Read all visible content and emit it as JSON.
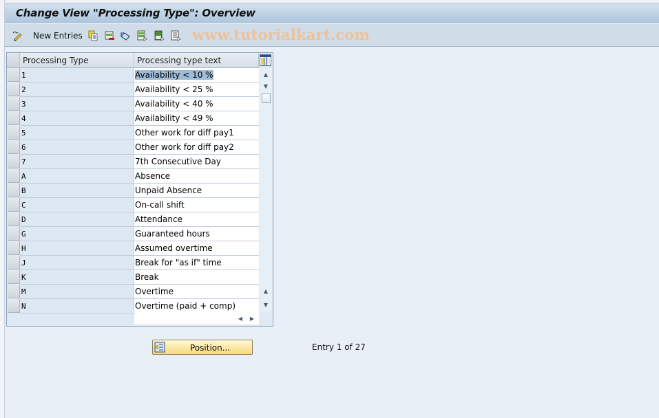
{
  "window": {
    "title": "Change View \"Processing Type\": Overview"
  },
  "toolbar": {
    "items": [
      {
        "icon": "edit-pencil-icon",
        "label": ""
      },
      {
        "icon": "",
        "label": "New Entries"
      },
      {
        "icon": "copy-icon",
        "label": ""
      },
      {
        "icon": "delete-icon",
        "label": ""
      },
      {
        "icon": "undo-change-icon",
        "label": ""
      },
      {
        "icon": "select-all-icon",
        "label": ""
      },
      {
        "icon": "select-block-icon",
        "label": ""
      },
      {
        "icon": "deselect-all-icon",
        "label": ""
      }
    ],
    "new_entries_label": "New Entries",
    "watermark": "www.tutorialkart.com"
  },
  "table": {
    "columns": [
      "Processing Type",
      "Processing type text"
    ],
    "rows": [
      {
        "key": "1",
        "text": "Availability < 10 %",
        "selected": true
      },
      {
        "key": "2",
        "text": "Availability < 25 %"
      },
      {
        "key": "3",
        "text": "Availability < 40 %"
      },
      {
        "key": "4",
        "text": "Availability < 49 %"
      },
      {
        "key": "5",
        "text": "Other work for diff pay1"
      },
      {
        "key": "6",
        "text": "Other work for diff pay2"
      },
      {
        "key": "7",
        "text": "7th Consecutive Day"
      },
      {
        "key": "A",
        "text": "Absence"
      },
      {
        "key": "B",
        "text": "Unpaid Absence"
      },
      {
        "key": "C",
        "text": "On-call shift"
      },
      {
        "key": "D",
        "text": "Attendance"
      },
      {
        "key": "G",
        "text": "Guaranteed hours"
      },
      {
        "key": "H",
        "text": "Assumed overtime"
      },
      {
        "key": "J",
        "text": "Break for \"as if\" time"
      },
      {
        "key": "K",
        "text": "Break"
      },
      {
        "key": "M",
        "text": "Overtime"
      },
      {
        "key": "N",
        "text": "Overtime (paid + comp)"
      }
    ],
    "column_settings_icon": "table-settings-icon"
  },
  "footer": {
    "position_button_label": "Position...",
    "entry_text": "Entry 1 of 27"
  },
  "colors": {
    "title_gradient_top": "#d2e1ee",
    "title_gradient_bottom": "#adc5dc",
    "toolbar_bg": "#d0dde8",
    "page_bg": "#e8eff7",
    "key_cell_bg": "#dde8f3",
    "selection": "#9ebbd8",
    "position_button": "#f7d97c",
    "watermark": "#f0bf93"
  }
}
